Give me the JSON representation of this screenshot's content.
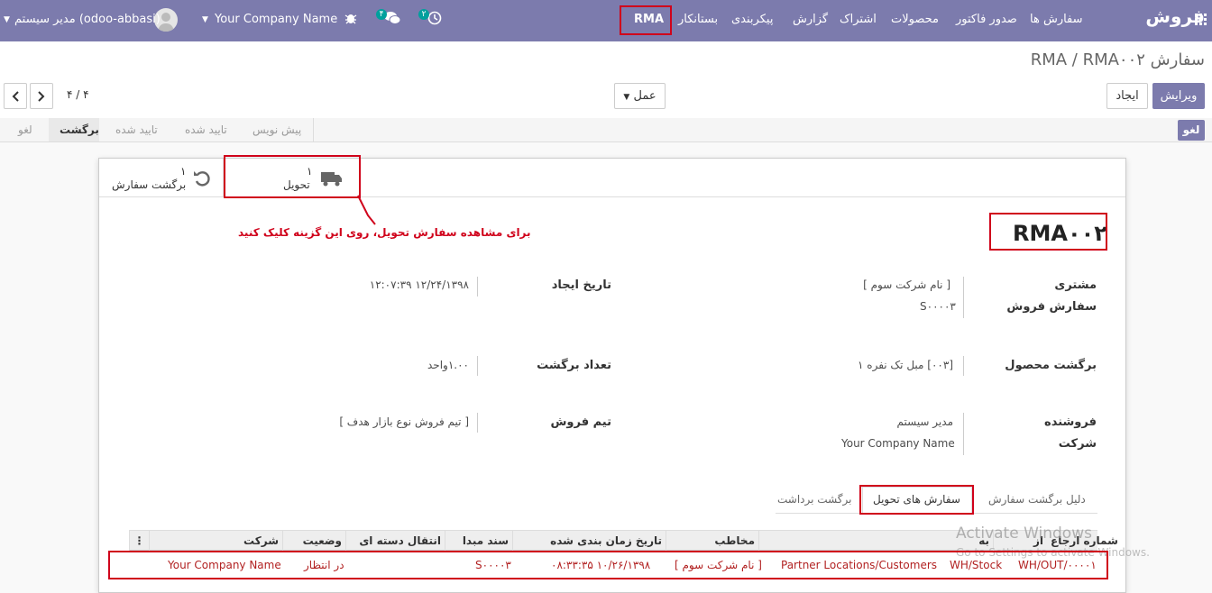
{
  "navbar": {
    "brand": "فروش",
    "menu": [
      "سفارش ها",
      "صدور فاکتور",
      "محصولات",
      "اشتراک",
      "گزارش",
      "پیکربندی",
      "بستانکار",
      "RMA"
    ],
    "user_name": "مدیر سیستم (odoo-abbasi)",
    "company": "Your Company Name",
    "messages_count": "۴",
    "activities_count": "۲"
  },
  "breadcrumb": "سفارش RMA / RMA۰۰۲",
  "buttons": {
    "edit": "ویرایش",
    "create": "ایجاد",
    "action": "عمل"
  },
  "pager": {
    "text": "۴ / ۴"
  },
  "status": {
    "cancel_button": "لغو",
    "stages": [
      "پیش نویس",
      "تایید شده",
      "تایید شده",
      "برگشت",
      "لغو"
    ],
    "active_stage": "برگشت"
  },
  "smart_buttons": {
    "delivery": {
      "count": "۱",
      "label": "تحویل"
    },
    "return_order": {
      "count": "۱",
      "label": "برگشت سفارش"
    }
  },
  "annotation": "برای مشاهده سفارش تحویل، روی این گزینه کلیک کنید",
  "record": {
    "name": "RMA۰۰۲",
    "customer_label": "مشتری",
    "customer_value": "[ نام شرکت سوم ]",
    "sale_order_label": "سفارش فروش",
    "sale_order_value": "S۰۰۰۰۳",
    "create_date_label": "تاریخ ایجاد",
    "create_date_value": "۱۲/۲۴/۱۳۹۸ ۱۲:۰۷:۳۹",
    "product_label": "برگشت محصول",
    "product_value": "[۰۰۳] مبل تک نفره ۱",
    "qty_label": "تعداد برگشت",
    "qty_value": "۱.۰۰واحد",
    "salesperson_label": "فروشنده",
    "salesperson_value": "مدیر سیستم",
    "company_label": "شرکت",
    "company_value": "Your Company Name",
    "team_label": "تیم فروش",
    "team_value": "[ تیم فروش نوع بازار هدف ]"
  },
  "tabs": [
    "دلیل برگشت سفارش",
    "سفارش های تحویل",
    "برگشت برداشت"
  ],
  "active_tab": "سفارش های تحویل",
  "table": {
    "headers": [
      "شماره ارجاع",
      "از",
      "به",
      "مخاطب",
      "تاریخ زمان بندی شده",
      "سند مبدا",
      "انتقال دسته ای",
      "وضعیت",
      "شرکت"
    ],
    "row": {
      "reference": "WH/OUT/۰۰۰۰۱",
      "from": "WH/Stock",
      "to": "Partner Locations/Customers",
      "contact": "[ نام شرکت سوم ]",
      "scheduled": "۱۰/۲۶/۱۳۹۸ ۰۸:۳۳:۳۵",
      "source": "S۰۰۰۰۳",
      "batch": "",
      "state": "در انتظار",
      "company": "Your Company Name"
    }
  },
  "watermark": {
    "title": "Activate Windows",
    "subtitle": "Go to Settings to activate Windows."
  },
  "colors": {
    "primary": "#7c7bad",
    "highlight": "#d0021b",
    "link": "#b22222"
  }
}
